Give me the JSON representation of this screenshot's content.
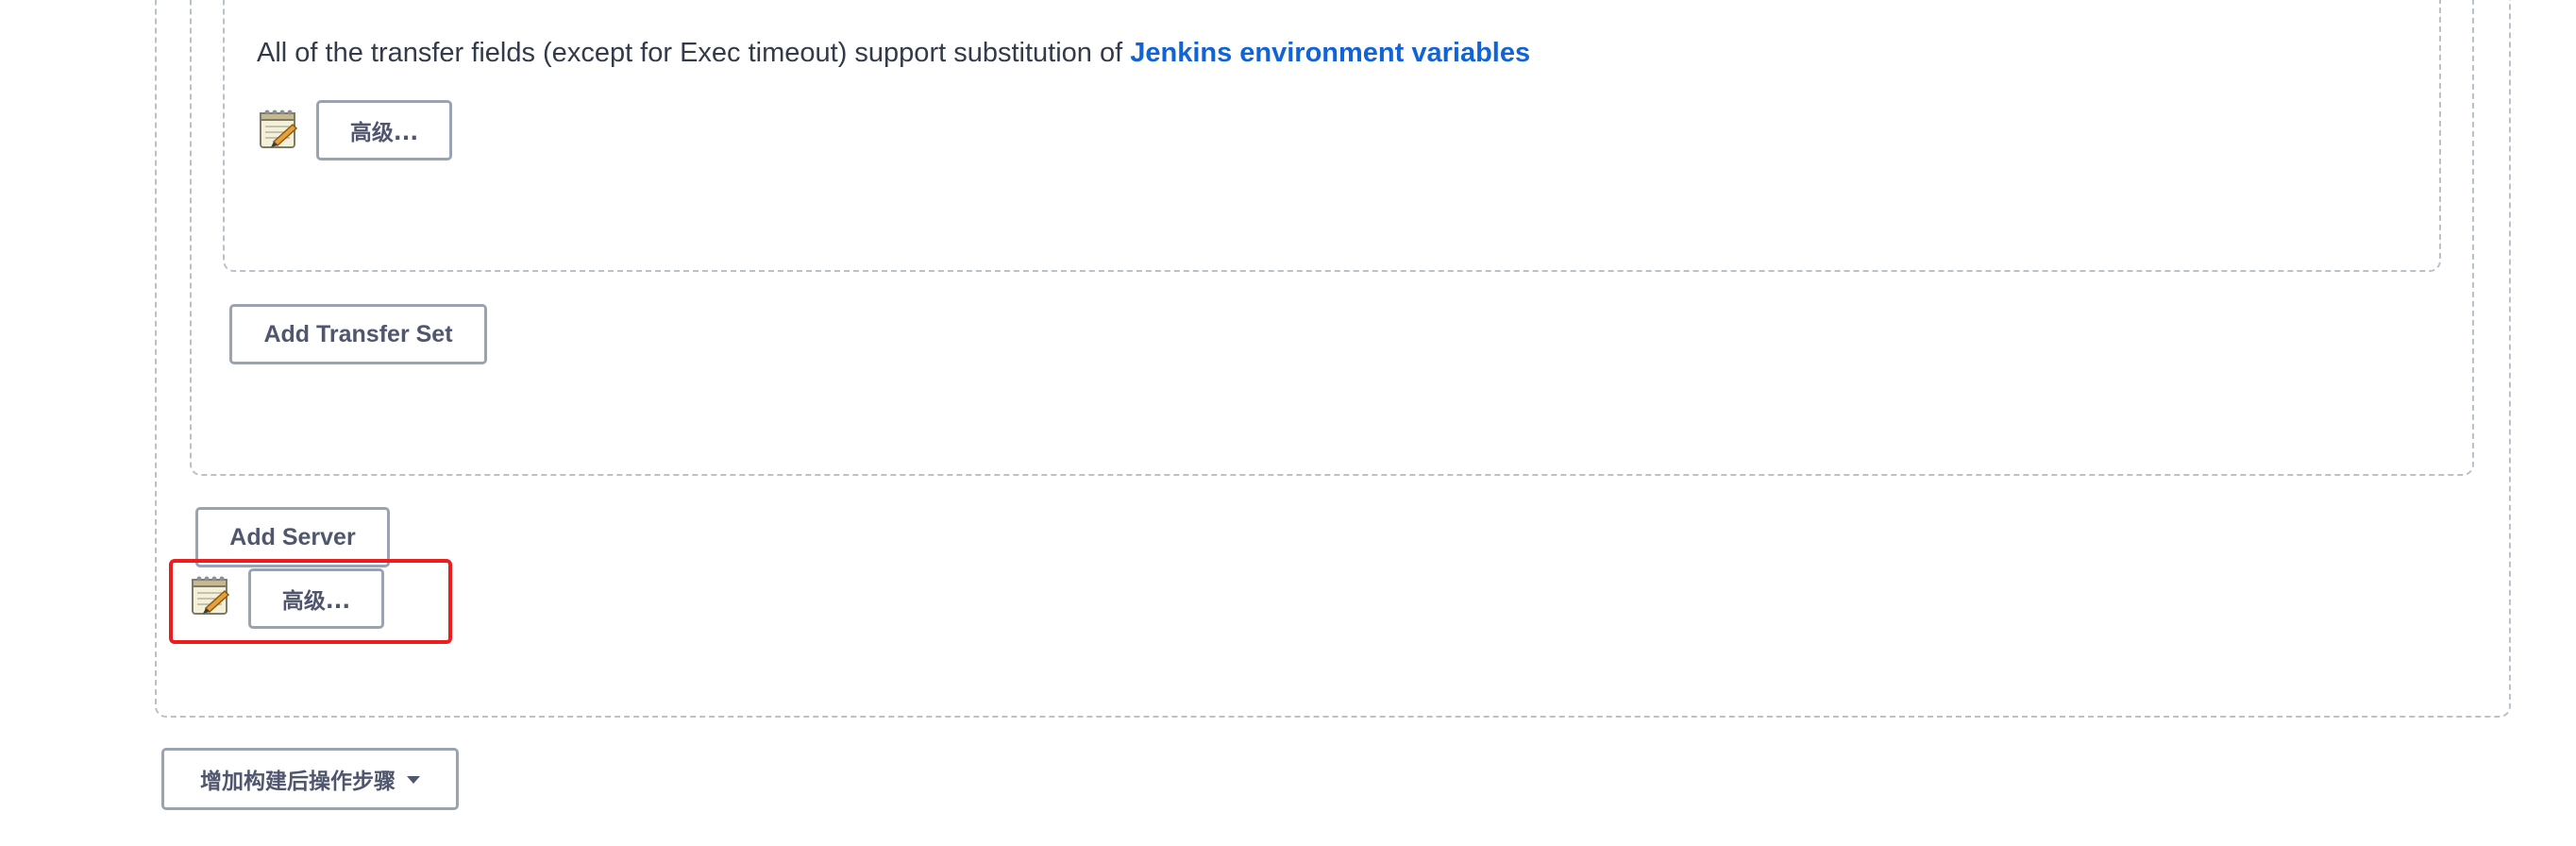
{
  "transfer_set": {
    "help_text": "All of the transfer fields (except for Exec timeout) support substitution of ",
    "help_link": "Jenkins environment variables",
    "advanced_button": "高级..."
  },
  "server": {
    "add_transfer_set_button": "Add Transfer Set"
  },
  "publisher": {
    "add_server_button": "Add Server",
    "advanced_button": "高级..."
  },
  "footer": {
    "add_post_build_step_button": "增加构建后操作步骤"
  },
  "colors": {
    "dashed_border": "#b9c2cc",
    "link": "#1263d6",
    "button_border": "#9aa3b2",
    "button_text": "#4f566e",
    "highlight": "#ee1c1c"
  },
  "icons": {
    "notepad": "notepad-pencil-icon",
    "dropdown": "caret-down-icon"
  }
}
